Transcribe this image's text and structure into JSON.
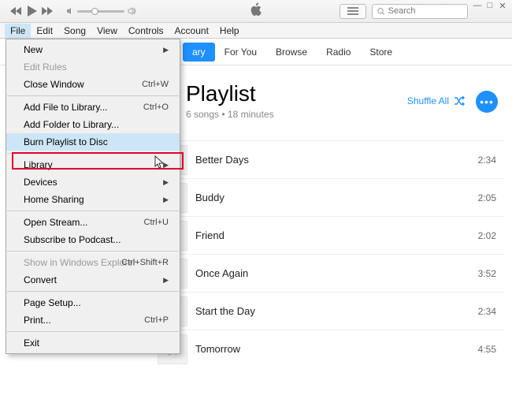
{
  "titlebar": {
    "searchPlaceholder": "Search"
  },
  "menubar": [
    "File",
    "Edit",
    "Song",
    "View",
    "Controls",
    "Account",
    "Help"
  ],
  "tabs": {
    "active": "ary",
    "items": [
      "For You",
      "Browse",
      "Radio",
      "Store"
    ]
  },
  "playlist": {
    "title": "Playlist",
    "meta": "6 songs • 18 minutes",
    "shuffle": "Shuffle All",
    "songs": [
      {
        "title": "Better Days",
        "time": "2:34"
      },
      {
        "title": "Buddy",
        "time": "2:05"
      },
      {
        "title": "Friend",
        "time": "2:02"
      },
      {
        "title": "Once Again",
        "time": "3:52"
      },
      {
        "title": "Start the Day",
        "time": "2:34"
      },
      {
        "title": "Tomorrow",
        "time": "4:55"
      }
    ]
  },
  "fileMenu": [
    {
      "label": "New",
      "arrow": true
    },
    {
      "label": "Edit Rules",
      "disabled": true
    },
    {
      "label": "Close Window",
      "shortcut": "Ctrl+W"
    },
    {
      "sep": true
    },
    {
      "label": "Add File to Library...",
      "shortcut": "Ctrl+O"
    },
    {
      "label": "Add Folder to Library..."
    },
    {
      "label": "Burn Playlist to Disc",
      "hover": true
    },
    {
      "sep": true
    },
    {
      "label": "Library",
      "arrow": true
    },
    {
      "label": "Devices",
      "arrow": true
    },
    {
      "label": "Home Sharing",
      "arrow": true
    },
    {
      "sep": true
    },
    {
      "label": "Open Stream...",
      "shortcut": "Ctrl+U"
    },
    {
      "label": "Subscribe to Podcast..."
    },
    {
      "sep": true
    },
    {
      "label": "Show in Windows Explorer",
      "shortcut": "Ctrl+Shift+R",
      "disabled": true
    },
    {
      "label": "Convert",
      "arrow": true
    },
    {
      "sep": true
    },
    {
      "label": "Page Setup..."
    },
    {
      "label": "Print...",
      "shortcut": "Ctrl+P"
    },
    {
      "sep": true
    },
    {
      "label": "Exit"
    }
  ]
}
